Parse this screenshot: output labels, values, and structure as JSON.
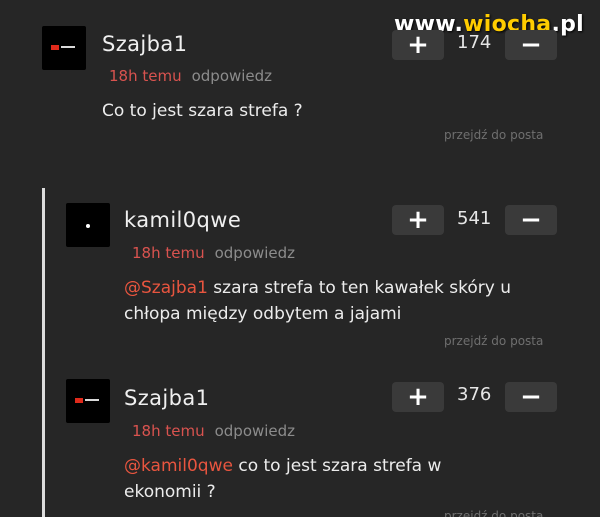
{
  "watermark": {
    "prefix": "www.",
    "brand": "wiocha",
    "suffix": ".pl"
  },
  "comments": [
    {
      "username": "Szajba1",
      "time": "18h temu",
      "reply_label": "odpowiedz",
      "mention": "",
      "text": "Co to jest szara strefa ?",
      "text_line2": "",
      "goto_label": "przejdź do posta",
      "votes": "174",
      "upvote_label": "+",
      "downvote_label": "−",
      "avatar": "red-logo-avatar"
    },
    {
      "username": "kamil0qwe",
      "time": "18h temu",
      "reply_label": "odpowiedz",
      "mention": "@Szajba1",
      "text": "szara strefa to ten kawałek skóry u",
      "text_line2": "chłopa między odbytem a jajami",
      "goto_label": "przejdź do posta",
      "votes": "541",
      "upvote_label": "+",
      "downvote_label": "−",
      "avatar": "dot-avatar"
    },
    {
      "username": "Szajba1",
      "time": "18h temu",
      "reply_label": "odpowiedz",
      "mention": "@kamil0qwe",
      "text": "co to jest szara strefa w",
      "text_line2": "ekonomii ?",
      "goto_label": "przejdź do posta",
      "votes": "376",
      "upvote_label": "+",
      "downvote_label": "−",
      "avatar": "red-logo-avatar"
    }
  ]
}
